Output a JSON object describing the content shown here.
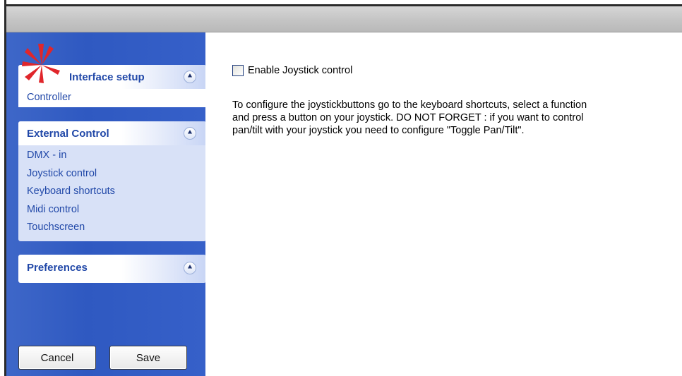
{
  "sidebar": {
    "panels": [
      {
        "title": "Interface setup",
        "items": [
          "Controller"
        ]
      },
      {
        "title": "External Control",
        "items": [
          "DMX - in",
          "Joystick control",
          "Keyboard shortcuts",
          "Midi control",
          "Touchscreen"
        ]
      },
      {
        "title": "Preferences",
        "items": []
      }
    ],
    "collapse_glyph": "≈",
    "buttons": {
      "cancel_label": "Cancel",
      "save_label": "Save"
    }
  },
  "content": {
    "checkbox_label": "Enable Joystick control",
    "checkbox_checked": false,
    "description_lines": [
      "To configure the joystickbuttons go to the keyboard shortcuts, select a function",
      "and press a button on your joystick. DO NOT FORGET : if you want to control",
      "pan/tilt with your joystick you need to configure \"Toggle Pan/Tilt\"."
    ]
  },
  "icons": {
    "logo": "starburst-logo-icon",
    "collapse": "double-chevron-up-icon",
    "checkbox": "checkbox-icon"
  },
  "colors": {
    "sidebar_blue": "#2f59c1",
    "panel_title": "#2148a8",
    "logo_red": "#e0262b"
  }
}
